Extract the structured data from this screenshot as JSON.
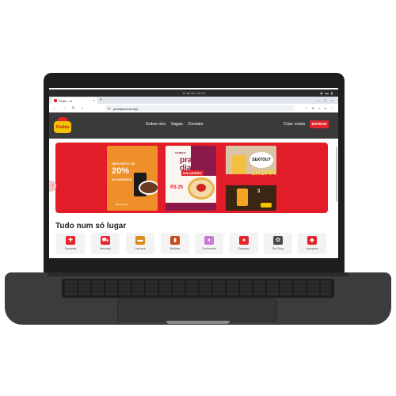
{
  "os": {
    "time": "12 de set.  12:04",
    "status_icons": "◉ ▬ ▮"
  },
  "browser": {
    "tab_title": "Pedid...ol",
    "tab_close": "×",
    "new_tab": "+",
    "window_controls": "— ☐ ×",
    "nav": "← → ↻ ⌂",
    "url_icon": "⇆",
    "url": "pedidjanomal.app",
    "ext_icons": "☆ ⊕ ◐ ● ⋮"
  },
  "site": {
    "logo_text": "Pedido",
    "nav": [
      "Sobre nós",
      "Vagas",
      "Contato"
    ],
    "signup": "Criar conta",
    "login": "ENTRAR"
  },
  "carousel": {
    "prev": "‹",
    "banner1": {
      "title": "DESCONTO DE",
      "pct": "20%",
      "sub": "NO MARMITA",
      "foot": "Baixe agora"
    },
    "banner2": {
      "logo": "COZINHA",
      "title": "prato do dia",
      "sub": "MACARRÃO",
      "price": "R$ 25"
    },
    "banner3": {
      "bubble": "SEXTOU?",
      "chopp": "CHOPP!",
      "num": "3"
    }
  },
  "section_title": "Tudo num só lugar",
  "categories": [
    {
      "label": "Farmácia",
      "icon": "✚",
      "color": "#e3262b"
    },
    {
      "label": "Mercado",
      "icon": "⛟",
      "color": "#e3262b"
    },
    {
      "label": "Lanches",
      "icon": "▬",
      "color": "#d98c1e"
    },
    {
      "label": "Bebidas",
      "icon": "▮",
      "color": "#c44b1e"
    },
    {
      "label": "Perfumaria",
      "icon": "♦",
      "color": "#c77ad6"
    },
    {
      "label": "Esportes",
      "icon": "●",
      "color": "#e3262b"
    },
    {
      "label": "Pet Shop",
      "icon": "✿",
      "color": "#4a4a4a"
    },
    {
      "label": "Açougues",
      "icon": "◆",
      "color": "#e3262b"
    }
  ]
}
